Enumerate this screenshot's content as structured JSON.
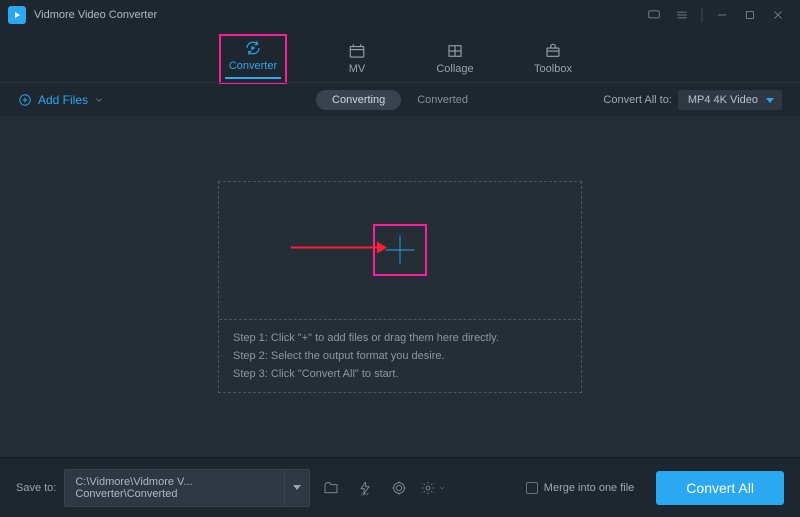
{
  "app": {
    "title": "Vidmore Video Converter"
  },
  "nav": {
    "converter": "Converter",
    "mv": "MV",
    "collage": "Collage",
    "toolbox": "Toolbox"
  },
  "toolbar": {
    "add_files": "Add Files",
    "converting": "Converting",
    "converted": "Converted",
    "convert_all_to": "Convert All to:",
    "format_selected": "MP4 4K Video"
  },
  "steps": {
    "s1": "Step 1: Click \"+\" to add files or drag them here directly.",
    "s2": "Step 2: Select the output format you desire.",
    "s3": "Step 3: Click \"Convert All\" to start."
  },
  "footer": {
    "save_to": "Save to:",
    "path": "C:\\Vidmore\\Vidmore V... Converter\\Converted",
    "merge": "Merge into one file",
    "convert_all": "Convert All"
  }
}
